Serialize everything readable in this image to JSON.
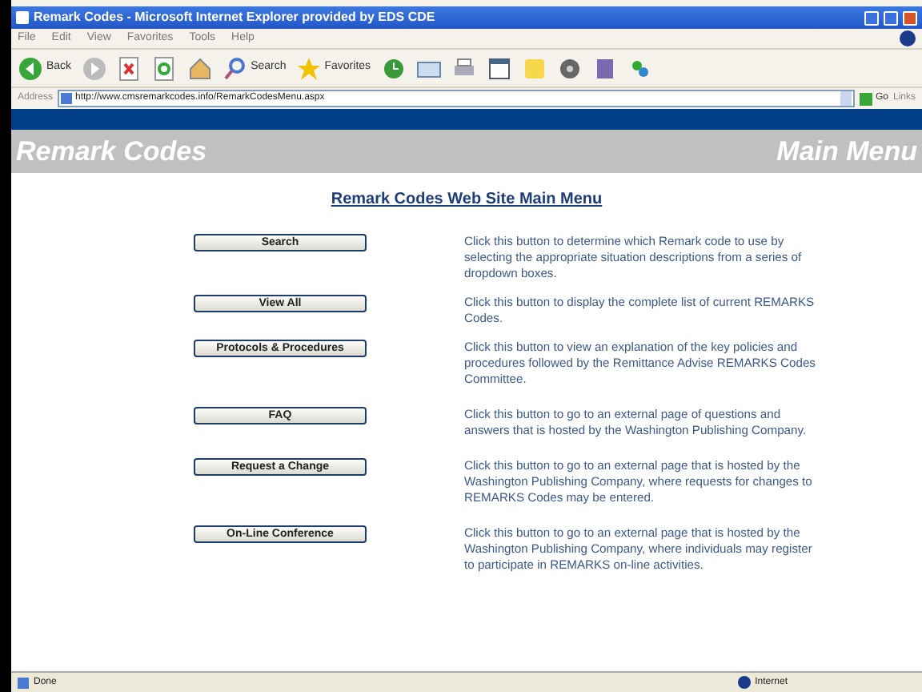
{
  "window": {
    "title": "Remark Codes - Microsoft Internet Explorer provided by EDS CDE"
  },
  "menu": [
    "File",
    "Edit",
    "View",
    "Favorites",
    "Tools",
    "Help"
  ],
  "toolbar": {
    "back": "Back",
    "search": "Search",
    "favorites": "Favorites"
  },
  "address_bar": {
    "label": "Address",
    "url": "http://www.cmsremarkcodes.info/RemarkCodesMenu.aspx",
    "go": "Go",
    "links": "Links"
  },
  "header": {
    "left": "Remark Codes",
    "right": "Main Menu"
  },
  "page_title": "Remark Codes Web Site Main Menu",
  "items": [
    {
      "button": "Search",
      "description": "Click this button to determine which Remark code to use by selecting the appropriate situation descriptions from a series of dropdown boxes."
    },
    {
      "button": "View All",
      "description": "Click this button to display the complete list of current REMARKS Codes."
    },
    {
      "button": "Protocols & Procedures",
      "description": "Click this button to view an explanation of the key policies and procedures followed by the Remittance Advise REMARKS Codes Committee."
    },
    {
      "button": "FAQ",
      "description": "Click this button to go to an external page of questions and answers that is hosted by the Washington Publishing Company."
    },
    {
      "button": "Request a Change",
      "description": "Click this button to go to an external page that is hosted by the Washington Publishing Company, where requests for changes to REMARKS Codes may be entered."
    },
    {
      "button": "On-Line Conference",
      "description": "Click this button to go to an external page that is hosted by the Washington Publishing Company, where individuals may register to participate in REMARKS on-line activities."
    }
  ],
  "status_bar": {
    "status": "Done",
    "zone": "Internet"
  }
}
